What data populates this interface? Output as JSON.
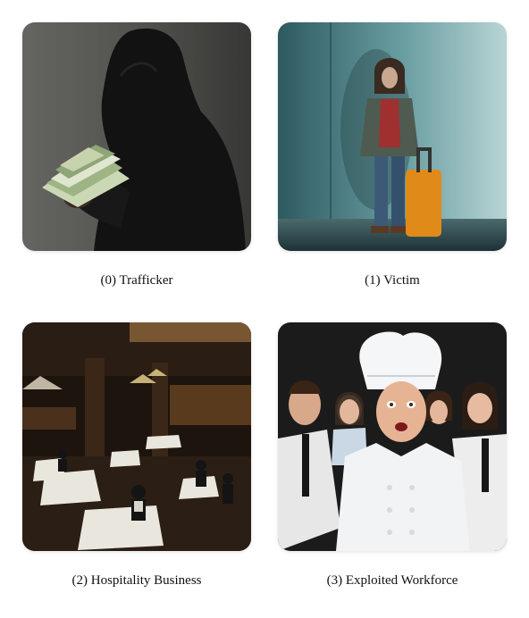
{
  "panels": [
    {
      "caption": "(0) Trafficker",
      "image": "hooded-figure-holding-cash"
    },
    {
      "caption": "(1) Victim",
      "image": "woman-with-orange-suitcase"
    },
    {
      "caption": "(2) Hospitality Business",
      "image": "restaurant-dining-room"
    },
    {
      "caption": "(3) Exploited Workforce",
      "image": "shocked-chef-and-waitstaff"
    }
  ]
}
